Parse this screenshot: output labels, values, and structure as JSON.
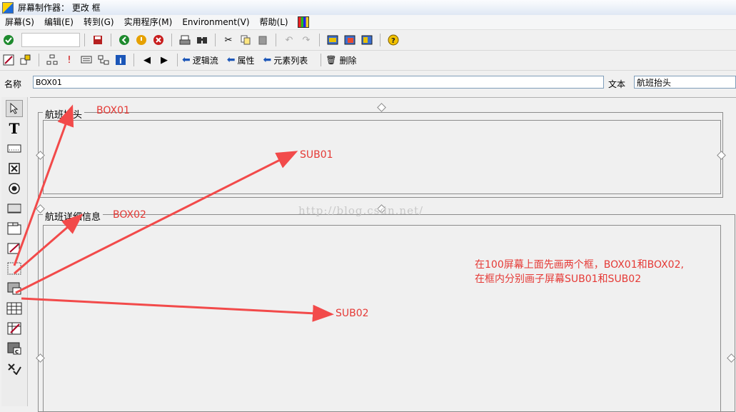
{
  "window": {
    "title": "屏幕制作器： 更改 框"
  },
  "menu": {
    "items": [
      "屏幕(S)",
      "编辑(E)",
      "转到(G)",
      "实用程序(M)",
      "Environment(V)",
      "帮助(L)"
    ]
  },
  "toolbar2": {
    "logic_flow": "逻辑流",
    "attributes": "属性",
    "element_list": "元素列表",
    "delete": "删除"
  },
  "namebar": {
    "name_label": "名称",
    "name_value": "BOX01",
    "text_label": "文本",
    "text_value": "航班抬头"
  },
  "boxes": {
    "box1_title": "航班抬头",
    "box2_title": "航班详细信息"
  },
  "annotations": {
    "box01": "BOX01",
    "box02": "BOX02",
    "sub01": "SUB01",
    "sub02": "SUB02",
    "note_line1": "在100屏幕上面先画两个框，BOX01和BOX02,",
    "note_line2": "在框内分别画子屏幕SUB01和SUB02"
  },
  "watermark": "http://blog.csdn.net/",
  "colors": {
    "annotation": "#e53935",
    "arrow": "#f24a4a"
  },
  "icons": {
    "palette": [
      "cursor-icon",
      "text-icon",
      "input-field-icon",
      "checkbox-icon",
      "radio-button-icon",
      "pushbutton-icon",
      "tabstrip-icon",
      "tabstrip-wizard-icon",
      "box-icon",
      "subscreen-icon",
      "table-control-icon",
      "table-wizard-icon",
      "custom-control-icon",
      "status-icon"
    ]
  }
}
